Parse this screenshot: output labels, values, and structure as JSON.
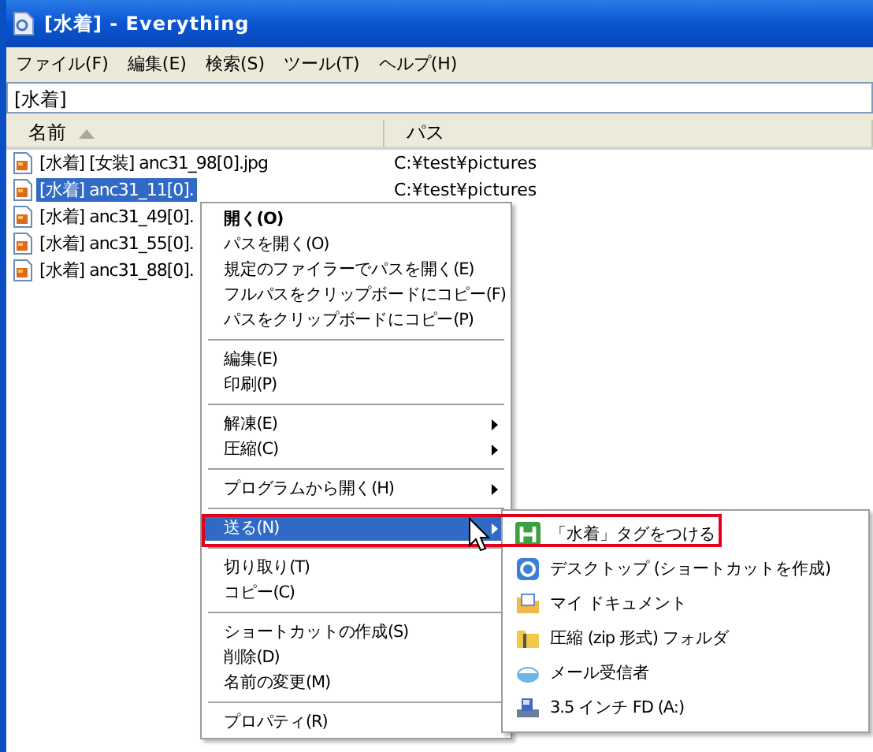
{
  "window": {
    "title": "[水着] - Everything"
  },
  "menu_bar": [
    {
      "label": "ファイル(F)"
    },
    {
      "label": "編集(E)"
    },
    {
      "label": "検索(S)"
    },
    {
      "label": "ツール(T)"
    },
    {
      "label": "ヘルプ(H)"
    }
  ],
  "search": {
    "value": "[水着]"
  },
  "table": {
    "columns": [
      {
        "label": "名前",
        "sorted": true
      },
      {
        "label": "パス",
        "sorted": false
      }
    ],
    "rows": [
      {
        "name": "[水着] [女装] anc31_98[0].jpg",
        "path": "C:¥test¥pictures",
        "selected": false
      },
      {
        "name": "[水着] anc31_11[0].",
        "path": "C:¥test¥pictures",
        "selected": true
      },
      {
        "name": "[水着] anc31_49[0].",
        "selected": false
      },
      {
        "name": "[水着] anc31_55[0].",
        "selected": false
      },
      {
        "name": "[水着] anc31_88[0].",
        "selected": false
      }
    ]
  },
  "context_menu": {
    "items": [
      {
        "kind": "item",
        "label": "開く(O)",
        "bold": true,
        "submenu": false,
        "selected": false
      },
      {
        "kind": "item",
        "label": "パスを開く(O)",
        "bold": false,
        "submenu": false,
        "selected": false
      },
      {
        "kind": "item",
        "label": "規定のファイラーでパスを開く(E)",
        "bold": false,
        "submenu": false,
        "selected": false
      },
      {
        "kind": "item",
        "label": "フルパスをクリップボードにコピー(F)",
        "bold": false,
        "submenu": false,
        "selected": false
      },
      {
        "kind": "item",
        "label": "パスをクリップボードにコピー(P)",
        "bold": false,
        "submenu": false,
        "selected": false
      },
      {
        "kind": "separator"
      },
      {
        "kind": "item",
        "label": "編集(E)",
        "bold": false,
        "submenu": false,
        "selected": false
      },
      {
        "kind": "item",
        "label": "印刷(P)",
        "bold": false,
        "submenu": false,
        "selected": false
      },
      {
        "kind": "separator"
      },
      {
        "kind": "item",
        "label": "解凍(E)",
        "bold": false,
        "submenu": true,
        "selected": false
      },
      {
        "kind": "item",
        "label": "圧縮(C)",
        "bold": false,
        "submenu": true,
        "selected": false
      },
      {
        "kind": "separator"
      },
      {
        "kind": "item",
        "label": "プログラムから開く(H)",
        "bold": false,
        "submenu": true,
        "selected": false
      },
      {
        "kind": "separator"
      },
      {
        "kind": "item",
        "label": "送る(N)",
        "bold": false,
        "submenu": true,
        "selected": true
      },
      {
        "kind": "separator"
      },
      {
        "kind": "item",
        "label": "切り取り(T)",
        "bold": false,
        "submenu": false,
        "selected": false
      },
      {
        "kind": "item",
        "label": "コピー(C)",
        "bold": false,
        "submenu": false,
        "selected": false
      },
      {
        "kind": "separator"
      },
      {
        "kind": "item",
        "label": "ショートカットの作成(S)",
        "bold": false,
        "submenu": false,
        "selected": false
      },
      {
        "kind": "item",
        "label": "削除(D)",
        "bold": false,
        "submenu": false,
        "selected": false
      },
      {
        "kind": "item",
        "label": "名前の変更(M)",
        "bold": false,
        "submenu": false,
        "selected": false
      },
      {
        "kind": "separator"
      },
      {
        "kind": "item",
        "label": "プロパティ(R)",
        "bold": false,
        "submenu": false,
        "selected": false
      }
    ]
  },
  "send_to_menu": {
    "items": [
      {
        "label": "「水着」タグをつける"
      },
      {
        "label": "デスクトップ (ショートカットを作成)"
      },
      {
        "label": "マイ ドキュメント"
      },
      {
        "label": "圧縮 (zip 形式) フォルダ"
      },
      {
        "label": "メール受信者"
      },
      {
        "label": "3.5 インチ FD (A:)"
      }
    ]
  },
  "highlight_box": true
}
